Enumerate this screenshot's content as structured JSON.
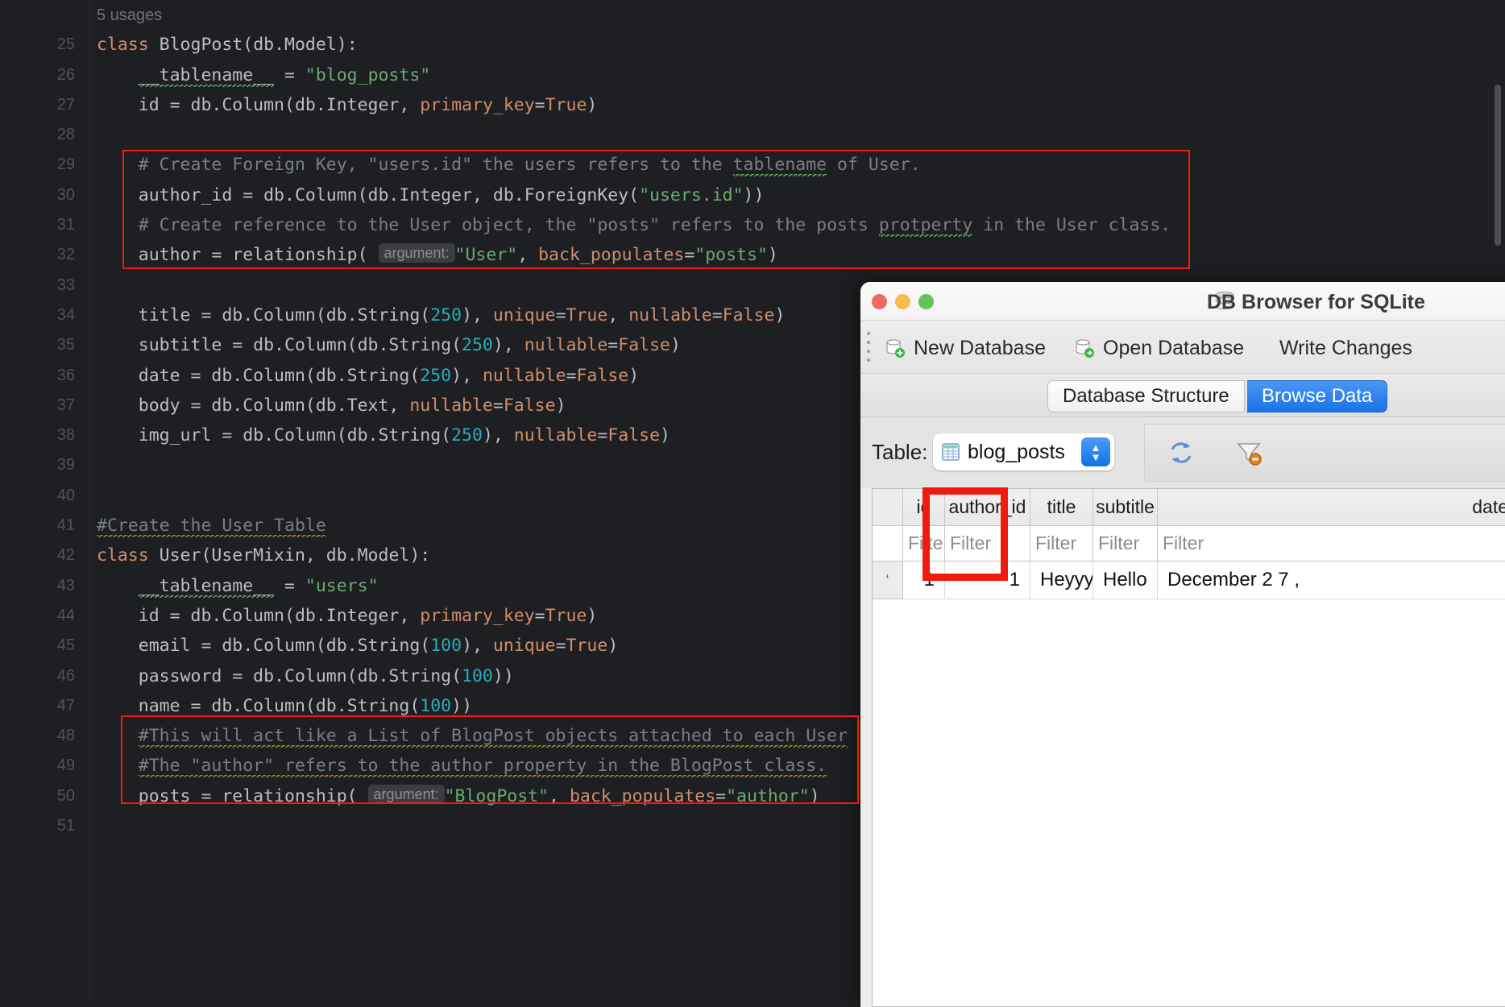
{
  "editor": {
    "usages_hint": "5 usages",
    "argument_hint": "argument:",
    "lines": [
      {
        "n": "25",
        "tokens": [
          {
            "t": "class ",
            "c": "kw"
          },
          {
            "t": "BlogPost",
            "c": "id"
          },
          {
            "t": "(",
            "c": "id"
          },
          {
            "t": "db.Model",
            "c": "id"
          },
          {
            "t": "):",
            "c": "id"
          }
        ]
      },
      {
        "n": "26",
        "tokens": [
          {
            "t": "    __tablename__ = ",
            "c": "id"
          },
          {
            "t": "\"blog_posts\"",
            "c": "str"
          }
        ]
      },
      {
        "n": "27",
        "tokens": [
          {
            "t": "    id = db.Column(db.Integer, ",
            "c": "id"
          },
          {
            "t": "primary_key",
            "c": "kwarg"
          },
          {
            "t": "=",
            "c": "id"
          },
          {
            "t": "True",
            "c": "kw"
          },
          {
            "t": ")",
            "c": "id"
          }
        ]
      },
      {
        "n": "28",
        "tokens": []
      },
      {
        "n": "29",
        "tokens": [
          {
            "t": "    # Create Foreign Key, \"users.id\" the users refers to the tablename of User.",
            "c": "cmt"
          }
        ]
      },
      {
        "n": "30",
        "tokens": [
          {
            "t": "    author_id = db.Column(db.Integer, db.ForeignKey(",
            "c": "id"
          },
          {
            "t": "\"users.id\"",
            "c": "str"
          },
          {
            "t": "))",
            "c": "id"
          }
        ]
      },
      {
        "n": "31",
        "tokens": [
          {
            "t": "    # Create reference to the User object, the \"posts\" refers to the posts protperty in the User class.",
            "c": "cmt"
          }
        ]
      },
      {
        "n": "32",
        "tokens": [
          {
            "t": "    author = relationship( ",
            "c": "id"
          },
          {
            "t": "\"User\"",
            "c": "str"
          },
          {
            "t": ", ",
            "c": "id"
          },
          {
            "t": "back_populates",
            "c": "kwarg"
          },
          {
            "t": "=",
            "c": "id"
          },
          {
            "t": "\"posts\"",
            "c": "str"
          },
          {
            "t": ")",
            "c": "id"
          }
        ]
      },
      {
        "n": "33",
        "tokens": []
      },
      {
        "n": "34",
        "tokens": [
          {
            "t": "    title = db.Column(db.String(",
            "c": "id"
          },
          {
            "t": "250",
            "c": "num"
          },
          {
            "t": "), ",
            "c": "id"
          },
          {
            "t": "unique",
            "c": "kwarg"
          },
          {
            "t": "=",
            "c": "id"
          },
          {
            "t": "True",
            "c": "kw"
          },
          {
            "t": ", ",
            "c": "id"
          },
          {
            "t": "nullable",
            "c": "kwarg"
          },
          {
            "t": "=",
            "c": "id"
          },
          {
            "t": "False",
            "c": "kw"
          },
          {
            "t": ")",
            "c": "id"
          }
        ]
      },
      {
        "n": "35",
        "tokens": [
          {
            "t": "    subtitle = db.Column(db.String(",
            "c": "id"
          },
          {
            "t": "250",
            "c": "num"
          },
          {
            "t": "), ",
            "c": "id"
          },
          {
            "t": "nullable",
            "c": "kwarg"
          },
          {
            "t": "=",
            "c": "id"
          },
          {
            "t": "False",
            "c": "kw"
          },
          {
            "t": ")",
            "c": "id"
          }
        ]
      },
      {
        "n": "36",
        "tokens": [
          {
            "t": "    date = db.Column(db.String(",
            "c": "id"
          },
          {
            "t": "250",
            "c": "num"
          },
          {
            "t": "), ",
            "c": "id"
          },
          {
            "t": "nullable",
            "c": "kwarg"
          },
          {
            "t": "=",
            "c": "id"
          },
          {
            "t": "False",
            "c": "kw"
          },
          {
            "t": ")",
            "c": "id"
          }
        ]
      },
      {
        "n": "37",
        "tokens": [
          {
            "t": "    body = db.Column(db.Text, ",
            "c": "id"
          },
          {
            "t": "nullable",
            "c": "kwarg"
          },
          {
            "t": "=",
            "c": "id"
          },
          {
            "t": "False",
            "c": "kw"
          },
          {
            "t": ")",
            "c": "id"
          }
        ]
      },
      {
        "n": "38",
        "tokens": [
          {
            "t": "    img_url = db.Column(db.String(",
            "c": "id"
          },
          {
            "t": "250",
            "c": "num"
          },
          {
            "t": "), ",
            "c": "id"
          },
          {
            "t": "nullable",
            "c": "kwarg"
          },
          {
            "t": "=",
            "c": "id"
          },
          {
            "t": "False",
            "c": "kw"
          },
          {
            "t": ")",
            "c": "id"
          }
        ]
      },
      {
        "n": "39",
        "tokens": []
      },
      {
        "n": "40",
        "tokens": []
      },
      {
        "n": "41",
        "tokens": [
          {
            "t": "#Create the User Table",
            "c": "cmt"
          }
        ]
      },
      {
        "n": "42",
        "tokens": [
          {
            "t": "class ",
            "c": "kw"
          },
          {
            "t": "User",
            "c": "id"
          },
          {
            "t": "(UserMixin, db.Model):",
            "c": "id"
          }
        ]
      },
      {
        "n": "43",
        "tokens": [
          {
            "t": "    __tablename__ = ",
            "c": "id"
          },
          {
            "t": "\"users\"",
            "c": "str"
          }
        ]
      },
      {
        "n": "44",
        "tokens": [
          {
            "t": "    id = db.Column(db.Integer, ",
            "c": "id"
          },
          {
            "t": "primary_key",
            "c": "kwarg"
          },
          {
            "t": "=",
            "c": "id"
          },
          {
            "t": "True",
            "c": "kw"
          },
          {
            "t": ")",
            "c": "id"
          }
        ]
      },
      {
        "n": "45",
        "tokens": [
          {
            "t": "    email = db.Column(db.String(",
            "c": "id"
          },
          {
            "t": "100",
            "c": "num"
          },
          {
            "t": "), ",
            "c": "id"
          },
          {
            "t": "unique",
            "c": "kwarg"
          },
          {
            "t": "=",
            "c": "id"
          },
          {
            "t": "True",
            "c": "kw"
          },
          {
            "t": ")",
            "c": "id"
          }
        ]
      },
      {
        "n": "46",
        "tokens": [
          {
            "t": "    password = db.Column(db.String(",
            "c": "id"
          },
          {
            "t": "100",
            "c": "num"
          },
          {
            "t": "))",
            "c": "id"
          }
        ]
      },
      {
        "n": "47",
        "tokens": [
          {
            "t": "    name = db.Column(db.String(",
            "c": "id"
          },
          {
            "t": "100",
            "c": "num"
          },
          {
            "t": "))",
            "c": "id"
          }
        ]
      },
      {
        "n": "48",
        "tokens": [
          {
            "t": "    #This will act like a List of BlogPost objects attached to each User",
            "c": "cmt"
          }
        ]
      },
      {
        "n": "49",
        "tokens": [
          {
            "t": "    #The \"author\" refers to the author property in the BlogPost class.",
            "c": "cmt"
          }
        ]
      },
      {
        "n": "50",
        "tokens": [
          {
            "t": "    posts = relationship( ",
            "c": "id"
          },
          {
            "t": "\"BlogPost\"",
            "c": "str"
          },
          {
            "t": ", ",
            "c": "id"
          },
          {
            "t": "back_populates",
            "c": "kwarg"
          },
          {
            "t": "=",
            "c": "id"
          },
          {
            "t": "\"author\"",
            "c": "str"
          },
          {
            "t": ")",
            "c": "id"
          }
        ]
      },
      {
        "n": "51",
        "tokens": []
      }
    ]
  },
  "dbwin": {
    "title": "DB Browser for SQLite",
    "toolbar": {
      "new_database": "New Database",
      "open_database": "Open Database",
      "write_changes": "Write Changes"
    },
    "tabs": [
      {
        "label": "Database Structure",
        "active": false
      },
      {
        "label": "Browse Data",
        "active": true
      }
    ],
    "selector": {
      "label": "Table:",
      "value": "blog_posts"
    },
    "grid": {
      "columns": [
        "id",
        "author_id",
        "title",
        "subtitle",
        "date"
      ],
      "filter_placeholders": [
        "Filte",
        "Filter",
        "Filter",
        "Filter",
        "Filter"
      ],
      "rows": [
        {
          "marker": "1",
          "cells": [
            "1",
            "1",
            "Heyyyy",
            "Hello",
            "December  2  7 ,"
          ]
        }
      ],
      "highlighted_column": "author_id"
    }
  },
  "colors": {
    "annotation_red": "#f01b0f",
    "editor_bg": "#1e1f22",
    "accent_blue": "#1a73e8"
  }
}
